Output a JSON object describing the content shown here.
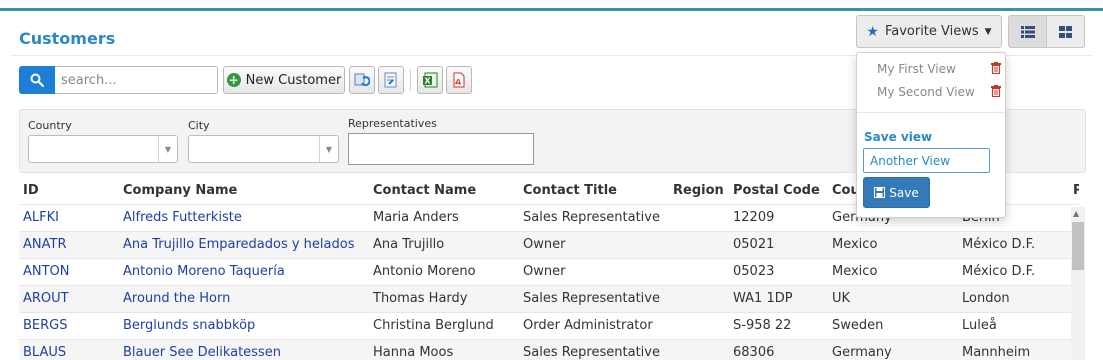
{
  "page": {
    "title": "Customers"
  },
  "toolbar": {
    "search_placeholder": "search...",
    "new_customer_label": "New Customer",
    "favorite_views_label": "Favorite Views"
  },
  "favorites": {
    "items": [
      {
        "label": "My First View"
      },
      {
        "label": "My Second View"
      }
    ],
    "save_label": "Save view",
    "input_value": "Another View",
    "save_button_label": "Save"
  },
  "filters": {
    "country_label": "Country",
    "city_label": "City",
    "representatives_label": "Representatives"
  },
  "table": {
    "columns": [
      "ID",
      "Company Name",
      "Contact Name",
      "Contact Title",
      "Region",
      "Postal Code",
      "Cou",
      "",
      "P"
    ],
    "rows": [
      {
        "id": "ALFKI",
        "company": "Alfreds Futterkiste",
        "contact": "Maria Anders",
        "title": "Sales Representative",
        "region": "",
        "postal": "12209",
        "country": "Germany",
        "city": "Berlin"
      },
      {
        "id": "ANATR",
        "company": "Ana Trujillo Emparedados y helados",
        "contact": "Ana Trujillo",
        "title": "Owner",
        "region": "",
        "postal": "05021",
        "country": "Mexico",
        "city": "México D.F."
      },
      {
        "id": "ANTON",
        "company": "Antonio Moreno Taquería",
        "contact": "Antonio Moreno",
        "title": "Owner",
        "region": "",
        "postal": "05023",
        "country": "Mexico",
        "city": "México D.F."
      },
      {
        "id": "AROUT",
        "company": "Around the Horn",
        "contact": "Thomas Hardy",
        "title": "Sales Representative",
        "region": "",
        "postal": "WA1 1DP",
        "country": "UK",
        "city": "London"
      },
      {
        "id": "BERGS",
        "company": "Berglunds snabbköp",
        "contact": "Christina Berglund",
        "title": "Order Administrator",
        "region": "",
        "postal": "S-958 22",
        "country": "Sweden",
        "city": "Luleå"
      },
      {
        "id": "BLAUS",
        "company": "Blauer See Delikatessen",
        "contact": "Hanna Moos",
        "title": "Sales Representative",
        "region": "",
        "postal": "68306",
        "country": "Germany",
        "city": "Mannheim"
      }
    ]
  },
  "icons": {
    "search": "search-icon",
    "refresh": "refresh-icon",
    "export": "export-icon",
    "excel": "excel-icon",
    "pdf": "pdf-icon",
    "star": "star-icon",
    "trash": "trash-icon",
    "save": "save-icon",
    "list_view": "list-view-icon",
    "grid_view": "grid-view-icon"
  },
  "colors": {
    "accent": "#2a8ac9",
    "primary_button": "#337ab7",
    "link": "#1f3fa6",
    "success": "#2e9b3f",
    "danger": "#c0392b"
  }
}
